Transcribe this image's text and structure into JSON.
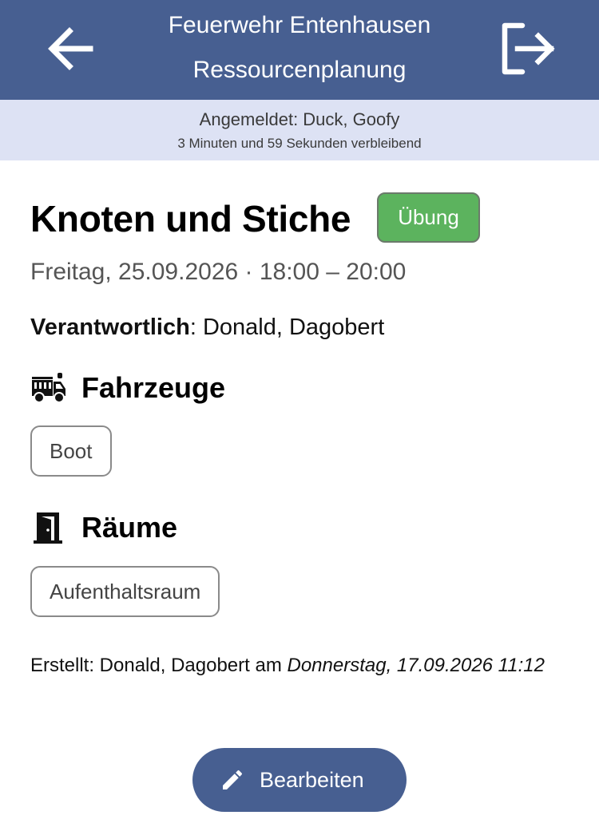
{
  "header": {
    "title_line1": "Feuerwehr Entenhausen",
    "title_line2": "Ressourcenplanung",
    "back_icon": "arrow-left-icon",
    "logout_icon": "logout-icon"
  },
  "session": {
    "logged_in": "Angemeldet: Duck, Goofy",
    "remaining": "3 Minuten und 59 Sekunden verbleibend"
  },
  "event": {
    "title": "Knoten und Stiche",
    "type": "Übung",
    "datetime": "Freitag, 25.09.2026 · 18:00 – 20:00",
    "responsible_label": "Verantwortlich",
    "responsible_value": ": Donald, Dagobert"
  },
  "vehicles": {
    "icon": "fire-truck-icon",
    "heading": "Fahrzeuge",
    "items": [
      "Boot"
    ]
  },
  "rooms": {
    "icon": "door-icon",
    "heading": "Räume",
    "items": [
      "Aufenthaltsraum"
    ]
  },
  "created": {
    "prefix": "Erstellt: Donald, Dagobert am ",
    "timestamp": "Donnerstag, 17.09.2026 11:12"
  },
  "edit_button": {
    "label": "Bearbeiten",
    "icon": "pencil-icon"
  },
  "colors": {
    "primary": "#475f91",
    "session_bar": "#dde2f4",
    "badge_green": "#5cb35e"
  }
}
